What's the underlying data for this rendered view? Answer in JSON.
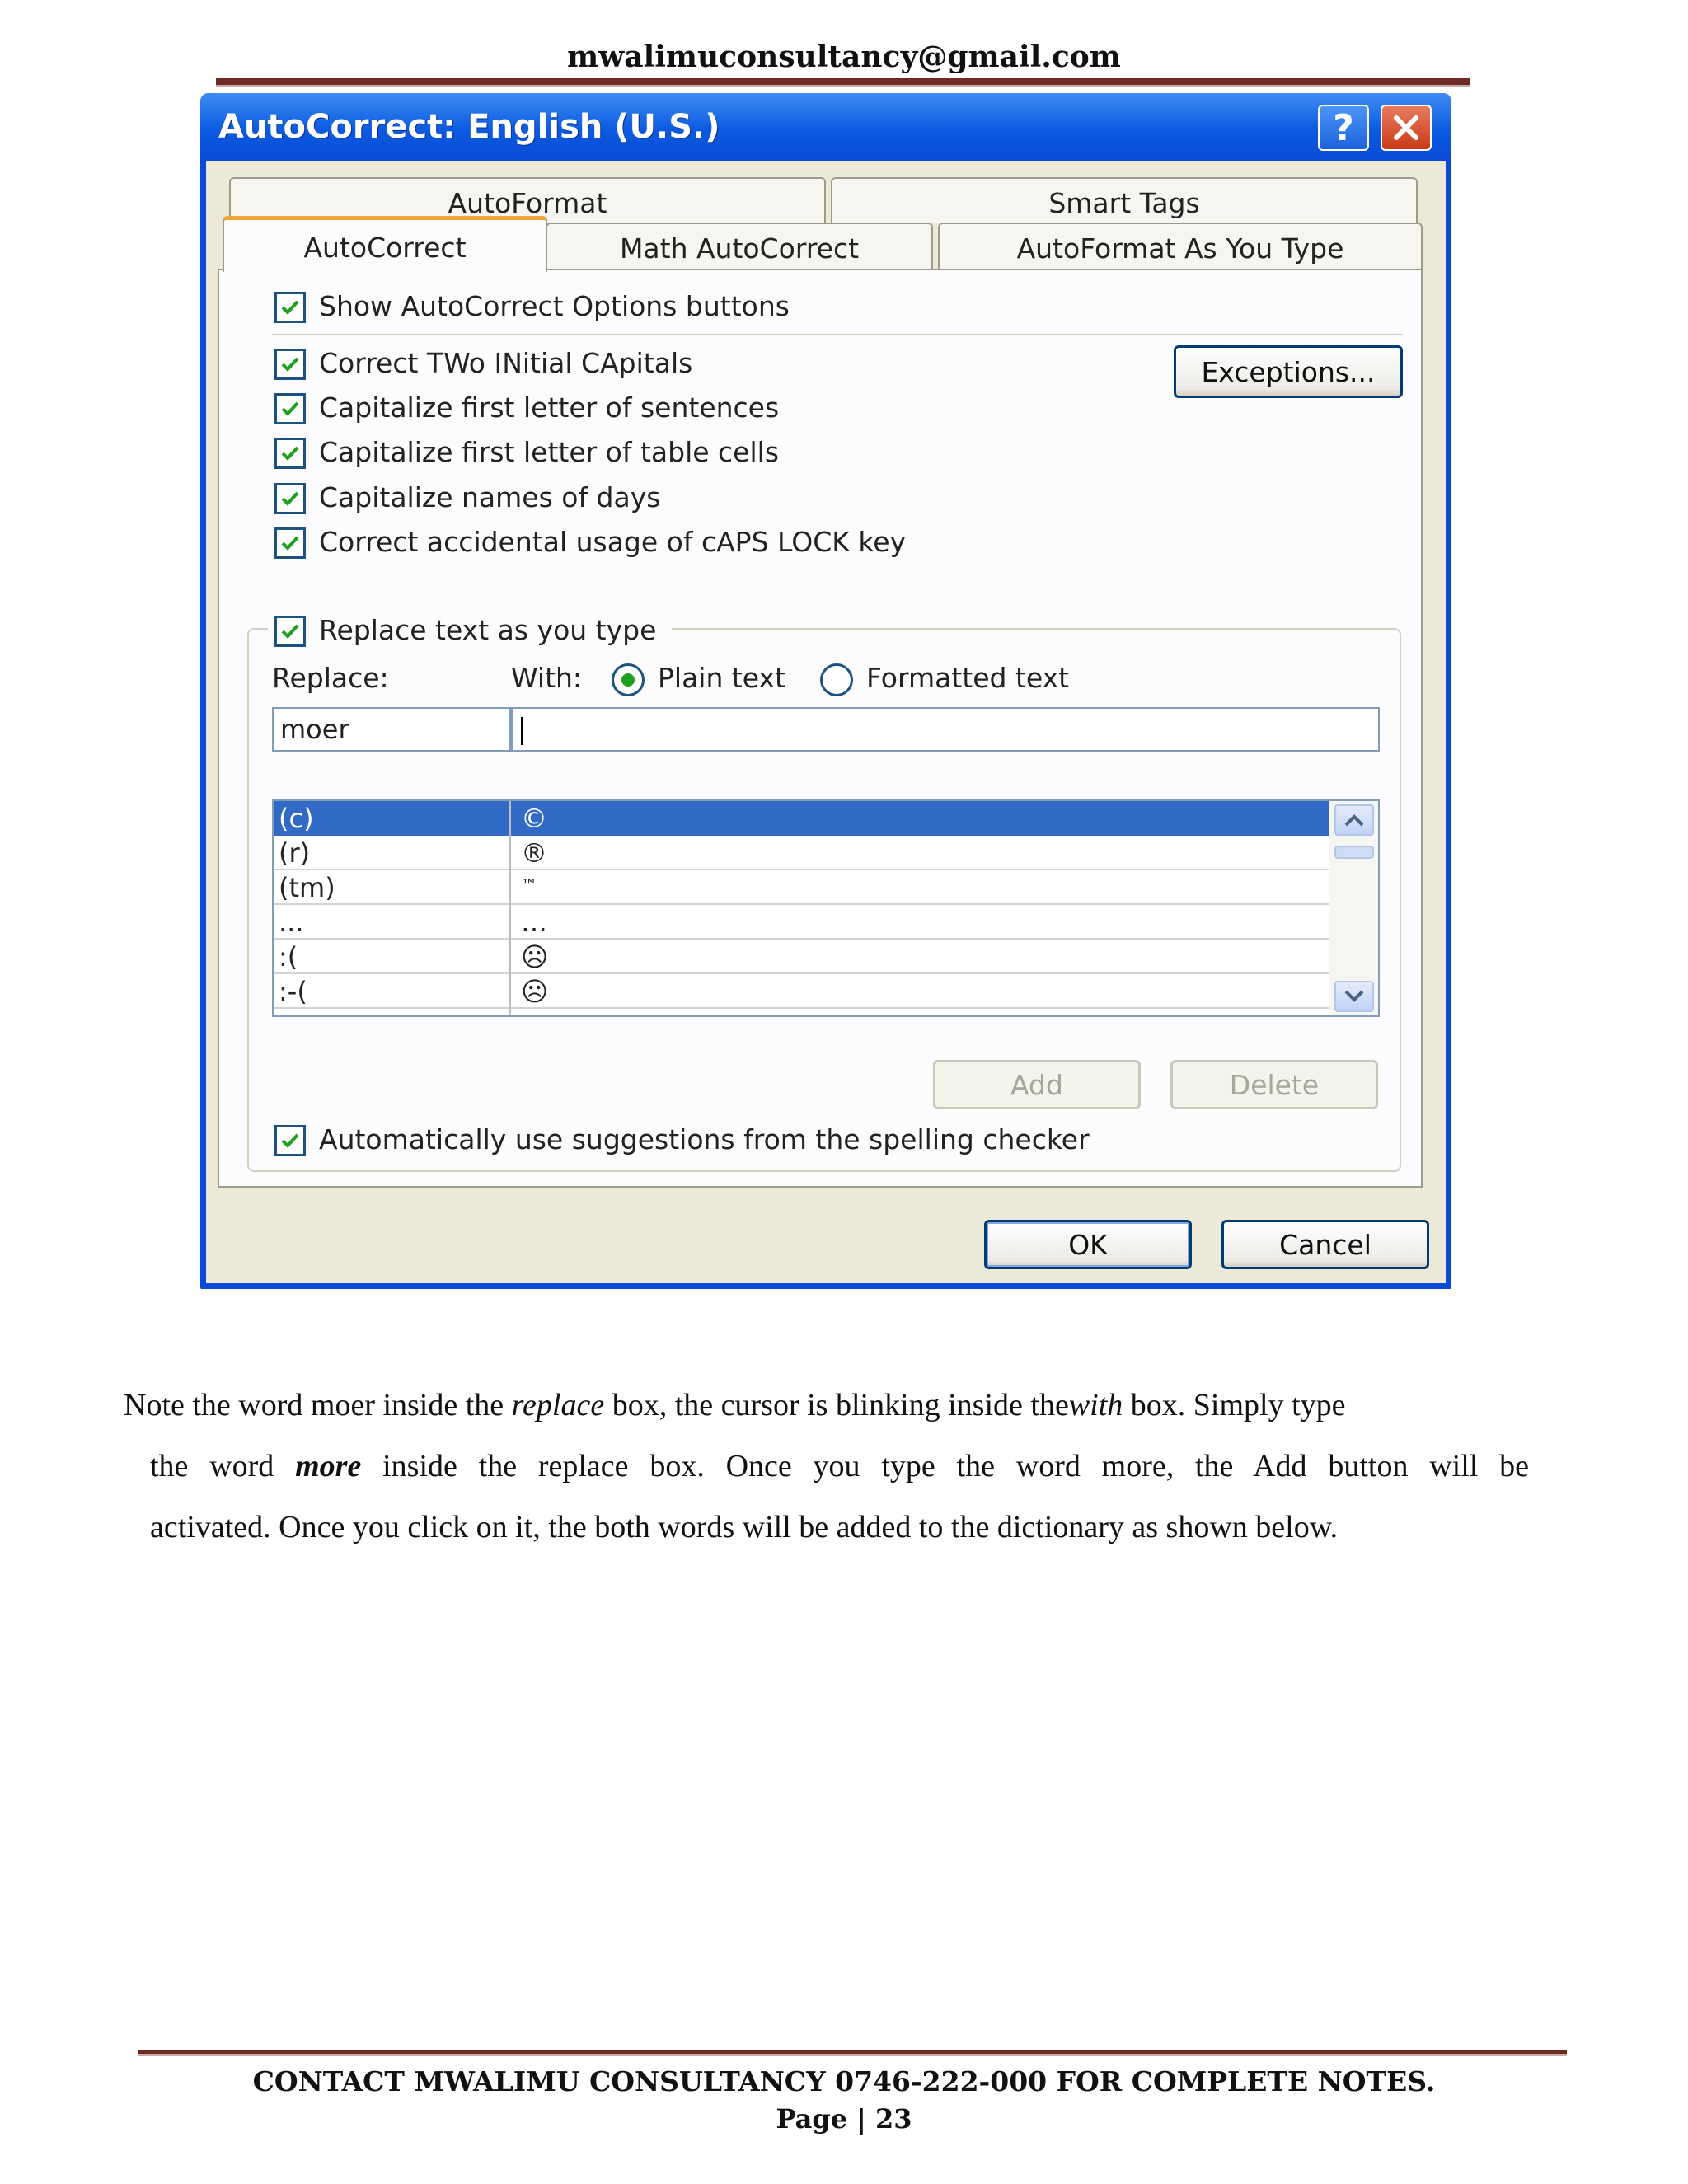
{
  "header": {
    "email": "mwalimuconsultancy@gmail.com"
  },
  "dialog": {
    "title": "AutoCorrect: English (U.S.)",
    "help_label": "?",
    "tabs": {
      "autoformat": "AutoFormat",
      "smart_tags": "Smart Tags",
      "autocorrect": "AutoCorrect",
      "math_autocorrect": "Math AutoCorrect",
      "autoformat_as_you_type": "AutoFormat As You Type"
    },
    "options": {
      "show_buttons": "Show AutoCorrect Options buttons",
      "two_initial_caps": "Correct TWo INitial CApitals",
      "cap_sentences": "Capitalize first letter of sentences",
      "cap_table_cells": "Capitalize first letter of table cells",
      "cap_days": "Capitalize names of days",
      "caps_lock": "Correct accidental usage of cAPS LOCK key",
      "replace_as_type": "Replace text as you type",
      "spelling_suggestions": "Automatically use suggestions from the spelling checker"
    },
    "exceptions_button": "Exceptions...",
    "replace_label": "Replace:",
    "with_label": "With:",
    "plain_text": "Plain text",
    "formatted_text": "Formatted text",
    "replace_value": "moer",
    "with_value": "",
    "entries": [
      {
        "replace": "(c)",
        "with": "©"
      },
      {
        "replace": "(r)",
        "with": "®"
      },
      {
        "replace": "(tm)",
        "with": "™"
      },
      {
        "replace": "...",
        "with": "…"
      },
      {
        "replace": ":(",
        "with": "☹"
      },
      {
        "replace": ":-(",
        "with": "☹"
      }
    ],
    "add_button": "Add",
    "delete_button": "Delete",
    "ok_button": "OK",
    "cancel_button": "Cancel"
  },
  "body": {
    "p1_a": "Note the word moer inside the ",
    "p1_em1": "replace",
    "p1_b": " box, the cursor is blinking inside the",
    "p1_em2": "with",
    "p1_c": " box. Simply type",
    "p2_a": "the word ",
    "p2_strong": "more",
    "p2_b": " inside the replace box. Once you type the word more, the Add button will be",
    "p3": "activated. Once you click on it, the both words will be added to the dictionary as shown below."
  },
  "footer": {
    "contact": "CONTACT MWALIMU CONSULTANCY  0746-222-000 FOR COMPLETE NOTES.",
    "page": "Page | 23"
  }
}
